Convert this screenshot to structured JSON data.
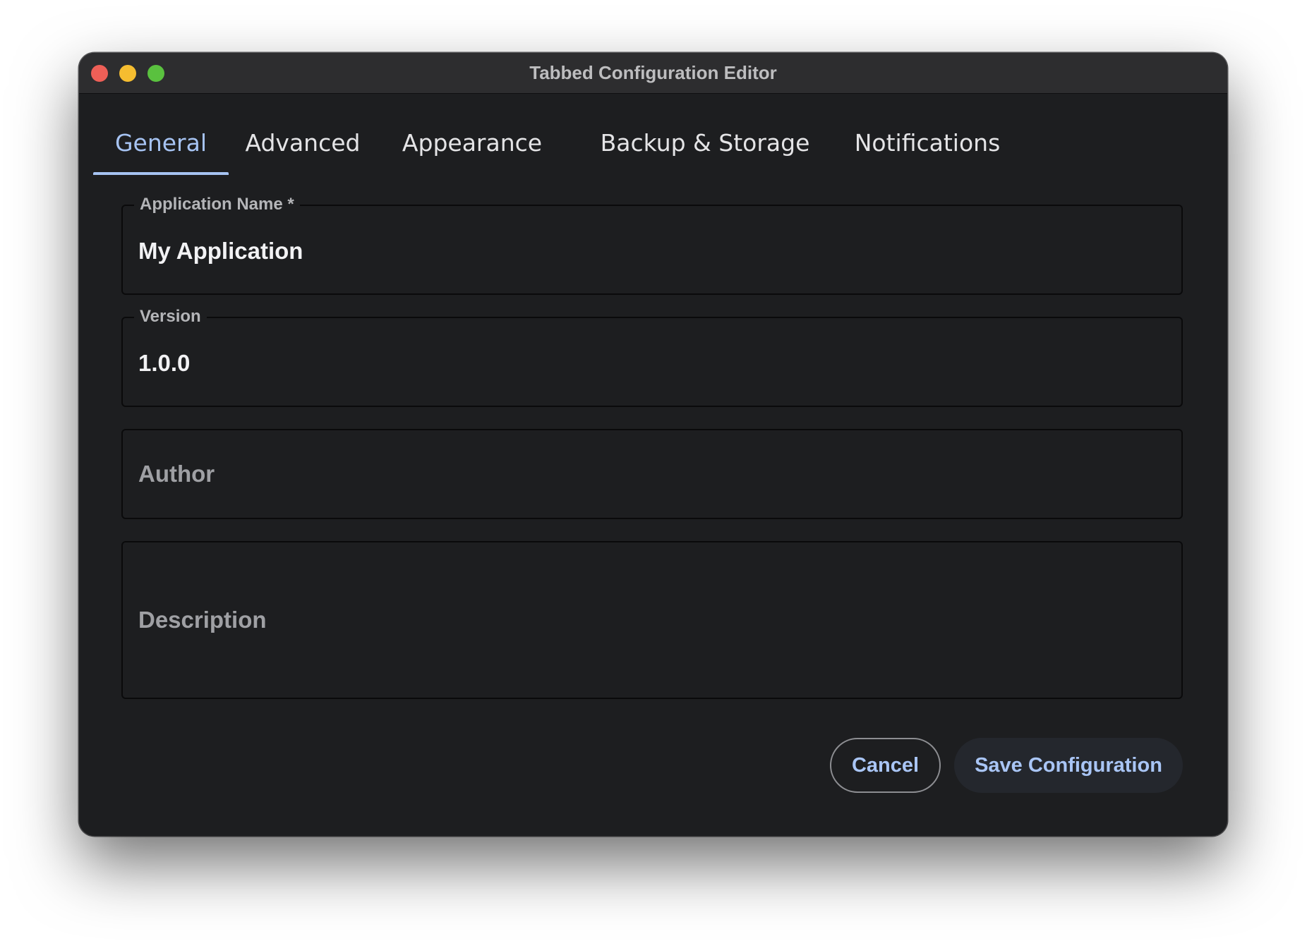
{
  "window": {
    "title": "Tabbed Configuration Editor"
  },
  "tabs": [
    {
      "label": "General",
      "active": true
    },
    {
      "label": "Advanced",
      "active": false
    },
    {
      "label": "Appearance",
      "active": false
    },
    {
      "label": "Backup & Storage",
      "active": false
    },
    {
      "label": "Notifications",
      "active": false
    }
  ],
  "form": {
    "application_name": {
      "label": "Application Name *",
      "value": "My Application"
    },
    "version": {
      "label": "Version",
      "value": "1.0.0"
    },
    "author": {
      "placeholder": "Author",
      "value": ""
    },
    "description": {
      "placeholder": "Description",
      "value": ""
    }
  },
  "actions": {
    "cancel_label": "Cancel",
    "save_label": "Save Configuration"
  },
  "colors": {
    "accent": "#a6c3f2",
    "window_bg": "#1d1e20",
    "titlebar_bg": "#2d2d2f",
    "close": "#ee5f57",
    "minimize": "#f5bd30",
    "maximize": "#5ac13f"
  }
}
